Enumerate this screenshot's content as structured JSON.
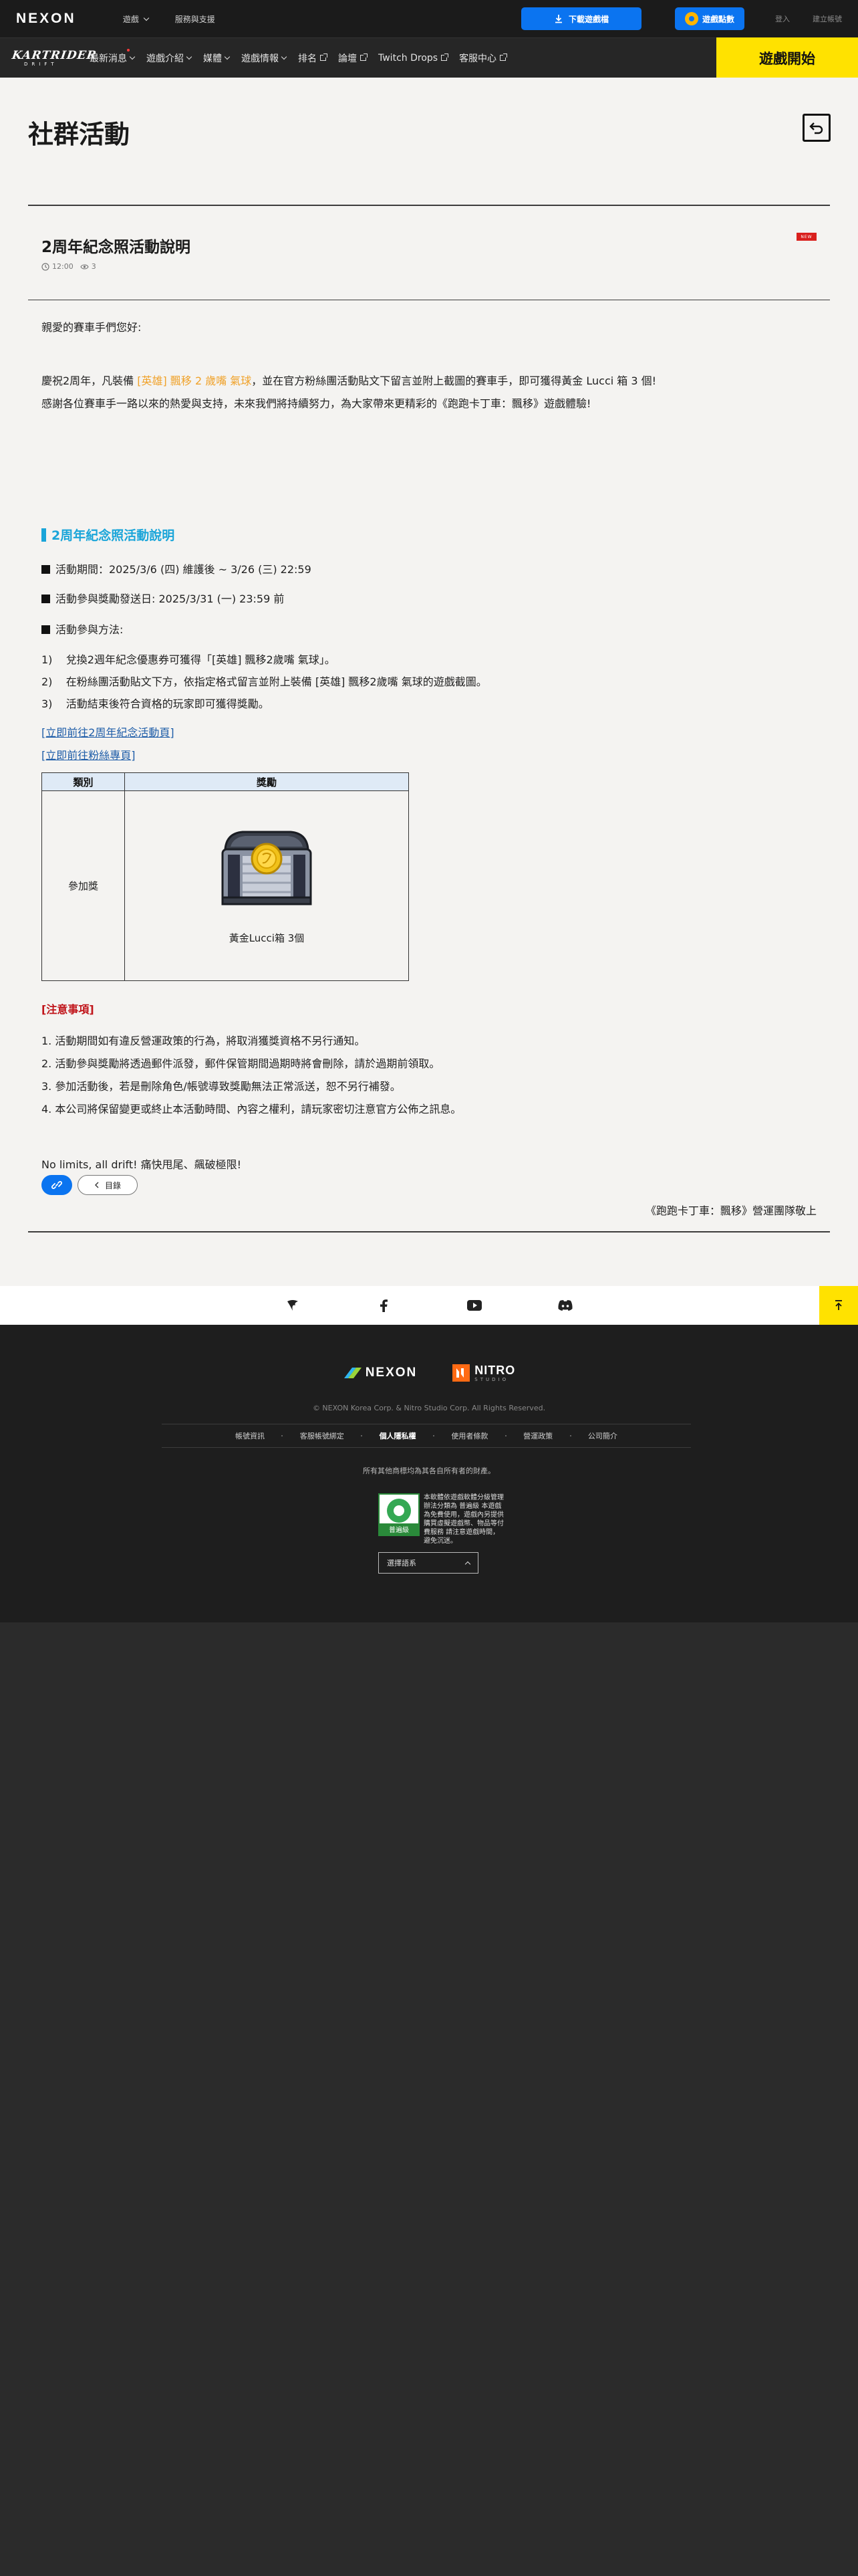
{
  "topbar": {
    "logo": "NEXON",
    "links": [
      "遊戲",
      "服務與支援"
    ],
    "download_label": "下載遊戲檔",
    "beanfun_label": "遊戲點數",
    "login": "登入",
    "register": "建立帳號"
  },
  "nav": {
    "logo_main": "KARTRIDER",
    "logo_sub": "DRIFT",
    "items": [
      {
        "label": "最新消息",
        "dropdown": true
      },
      {
        "label": "遊戲介紹",
        "dropdown": true
      },
      {
        "label": "媒體",
        "dropdown": true
      },
      {
        "label": "遊戲情報",
        "dropdown": true
      },
      {
        "label": "排名",
        "external": true
      },
      {
        "label": "論壇",
        "external": true
      },
      {
        "label": "Twitch Drops",
        "external": true
      },
      {
        "label": "客服中心",
        "external": true
      }
    ],
    "start_label": "遊戲開始"
  },
  "page": {
    "title": "社群活動"
  },
  "post": {
    "title": "2周年紀念照活動說明",
    "time": "12:00",
    "views": "3",
    "badge": "NEW",
    "greeting": "親愛的賽車手們您好:",
    "intro_1_pre": "慶祝2周年，凡裝備 ",
    "intro_1_hl": "[英雄] 飄移 2 歲嘴 氣球",
    "intro_1_post": "，並在官方粉絲團活動貼文下留言並附上截圖的賽車手，即可獲得黃金 Lucci 箱 3 個!",
    "intro_2": "感謝各位賽車手一路以來的熱愛與支持，未來我們將持續努力，為大家帶來更精彩的《跑跑卡丁車：飄移》遊戲體驗!",
    "section_title": "2周年紀念照活動說明",
    "period": "活動期間：2025/3/6 (四) 維護後 ~ 3/26 (三) 22:59",
    "reward_date": "活動參與獎勵發送日:   2025/3/31 (一) 23:59 前",
    "method_title": "活動參與方法:",
    "steps": [
      "1)    兌換2週年紀念優惠券可獲得「[英雄] 飄移2歲嘴 氣球」。",
      "2)    在粉絲團活動貼文下方，依指定格式留言並附上裝備 [英雄] 飄移2歲嘴 氣球的遊戲截圖。",
      "3)    活動結束後符合資格的玩家即可獲得獎勵。"
    ],
    "link_1": "[立即前往2周年紀念活動頁]",
    "link_2": "[立即前往粉絲專頁]",
    "table": {
      "col_1": "類別",
      "col_2": "獎勵",
      "category": "參加獎",
      "reward": "黃金Lucci箱 3個"
    },
    "notice_title": "[注意事項]",
    "notices": [
      "1. 活動期間如有違反營運政策的行為，將取消獲獎資格不另行通知。",
      "2. 活動參與獎勵將透過郵件派發，郵件保管期間過期時將會刪除，請於過期前領取。",
      "3. 參加活動後，若是刪除角色/帳號導致獎勵無法正常派送，恕不另行補發。",
      "4. 本公司將保留變更或終止本活動時間、內容之權利，請玩家密切注意官方公佈之訊息。"
    ],
    "closing": "No limits, all drift! 痛快甩尾、飆破極限!",
    "signature": "《跑跑卡丁車：飄移》營運團隊敬上",
    "list_button": "目錄"
  },
  "footer": {
    "nexon": "NEXON",
    "nitro": "NITRO",
    "nitro_sub": "STUDIO",
    "copyright": "© NEXON Korea Corp. & Nitro Studio Corp. All Rights Reserved.",
    "links": [
      "帳號資訊",
      "客服帳號綁定",
      "個人隱私權",
      "使用者條款",
      "營運政策",
      "公司簡介"
    ],
    "note": "所有其他商標均為其各自所有者的財產。",
    "rating_label": "普遍級",
    "rating_text": "本軟體依遊戲軟體分級管理辦法分類為 普遍級 本遊戲為免費使用，遊戲內另提供購買虛擬遊戲幣、物品等付費服務 請注意遊戲時間，避免沉迷。",
    "language": "選擇語系"
  },
  "colors": {
    "accent_blue": "#0b74f0",
    "start_yellow": "#ffe200",
    "section_blue": "#1aa5d9",
    "highlight_orange": "#f0a22a",
    "notice_red": "#c0141a"
  }
}
